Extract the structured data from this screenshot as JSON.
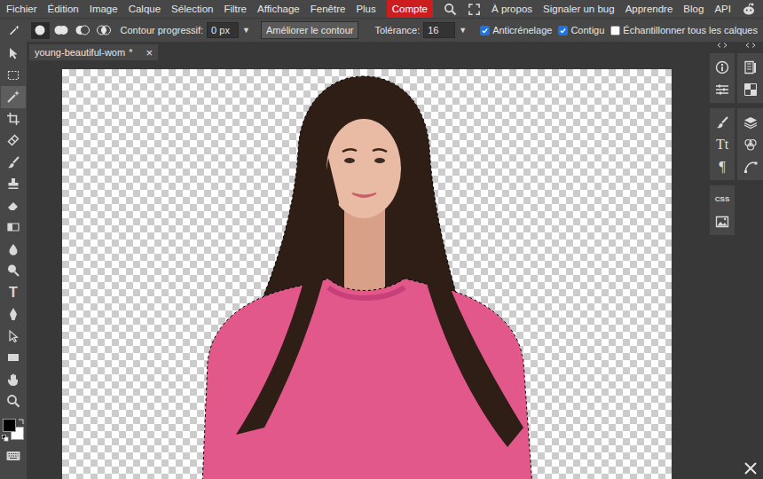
{
  "menu": [
    {
      "label": "Fichier"
    },
    {
      "label": "Édition"
    },
    {
      "label": "Image"
    },
    {
      "label": "Calque"
    },
    {
      "label": "Sélection"
    },
    {
      "label": "Filtre"
    },
    {
      "label": "Affichage"
    },
    {
      "label": "Fenêtre"
    },
    {
      "label": "Plus"
    }
  ],
  "account": "Compte",
  "links": [
    "À propos",
    "Signaler un bug",
    "Apprendre",
    "Blog",
    "API"
  ],
  "options": {
    "selection_modes": [
      {
        "selected": true
      },
      {
        "selected": false
      },
      {
        "selected": false
      },
      {
        "selected": false
      }
    ],
    "feather": {
      "label": "Contour progressif:",
      "value": "0 px",
      "arrow": "▼"
    },
    "refine_button": "Améliorer le contour",
    "tolerance": {
      "label": "Tolérance:",
      "value": "16",
      "arrow": "▼"
    },
    "checkboxes": [
      {
        "label": "Anticrénelage",
        "checked": true
      },
      {
        "label": "Contigu",
        "checked": true
      },
      {
        "label": "Échantillonner tous les calques",
        "checked": false
      }
    ]
  },
  "document_tab": {
    "title": "young-beautiful-wom",
    "modified": "*",
    "close": "×",
    "selected": true
  },
  "tools": [
    {
      "kind": "icon",
      "selected": false
    },
    {
      "kind": "icon",
      "selected": false
    },
    {
      "kind": "icon",
      "selected": true
    },
    {
      "kind": "icon",
      "selected": false
    },
    {
      "kind": "icon",
      "selected": false
    },
    {
      "kind": "icon",
      "selected": false
    },
    {
      "kind": "icon",
      "selected": false
    },
    {
      "kind": "icon",
      "selected": false
    },
    {
      "kind": "icon",
      "selected": false
    },
    {
      "kind": "icon",
      "selected": false
    },
    {
      "kind": "icon",
      "selected": false
    },
    {
      "kind": "glyph",
      "label": "T",
      "selected": false
    },
    {
      "kind": "icon",
      "selected": false
    },
    {
      "kind": "icon",
      "selected": false
    },
    {
      "kind": "icon",
      "selected": false
    },
    {
      "kind": "icon",
      "selected": false
    },
    {
      "kind": "icon",
      "selected": false
    }
  ],
  "swatches": {
    "foreground": "#000000",
    "background": "#ffffff"
  },
  "right_panel": [
    {
      "groups": [
        [
          {
            "kind": "icon"
          },
          {
            "kind": "icon"
          }
        ],
        [
          {
            "kind": "icon"
          },
          {
            "kind": "glyph",
            "label": "Tt"
          },
          {
            "kind": "glyph",
            "label": "¶"
          }
        ],
        [
          {
            "kind": "glyph",
            "label": "CSS"
          },
          {
            "kind": "icon"
          }
        ]
      ]
    },
    {
      "groups": [
        [
          {
            "kind": "icon"
          },
          {
            "kind": "icon"
          }
        ],
        [
          {
            "kind": "icon"
          },
          {
            "kind": "icon"
          },
          {
            "kind": "icon"
          }
        ]
      ]
    }
  ]
}
